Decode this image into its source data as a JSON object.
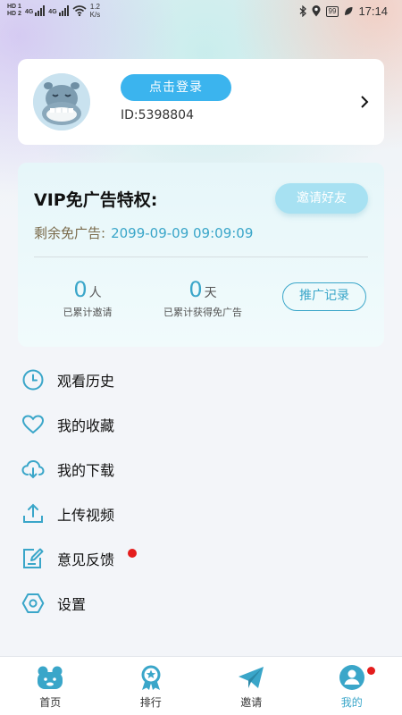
{
  "status_bar": {
    "hd1": "HD 1",
    "hd2": "HD 2",
    "net1": "4G",
    "net2": "4G",
    "speed_value": "1.2",
    "speed_unit": "K/s",
    "battery": "99",
    "time": "17:14"
  },
  "profile": {
    "login_label": "点击登录",
    "user_id": "ID:5398804"
  },
  "vip": {
    "title": "VIP免广告特权:",
    "invite_label": "邀请好友",
    "remain_label": "剩余免广告:",
    "remain_value": "2099-09-09 09:09:09",
    "invited_count": "0",
    "invited_unit": "人",
    "invited_label": "已累计邀请",
    "days_count": "0",
    "days_unit": "天",
    "days_label": "已累计获得免广告",
    "record_label": "推广记录"
  },
  "menu": {
    "items": [
      {
        "label": "观看历史",
        "icon": "clock-icon"
      },
      {
        "label": "我的收藏",
        "icon": "heart-icon"
      },
      {
        "label": "我的下载",
        "icon": "cloud-download-icon"
      },
      {
        "label": "上传视频",
        "icon": "upload-icon"
      },
      {
        "label": "意见反馈",
        "icon": "feedback-icon"
      },
      {
        "label": "设置",
        "icon": "settings-icon"
      }
    ]
  },
  "tabbar": {
    "tabs": [
      {
        "label": "首页",
        "icon": "home-icon"
      },
      {
        "label": "排行",
        "icon": "ranking-icon"
      },
      {
        "label": "邀请",
        "icon": "paper-plane-icon"
      },
      {
        "label": "我的",
        "icon": "profile-icon",
        "active": true
      }
    ]
  },
  "colors": {
    "accent": "#3aa6c9",
    "login_button": "#3bb4ee",
    "badge": "#e41d1d"
  }
}
